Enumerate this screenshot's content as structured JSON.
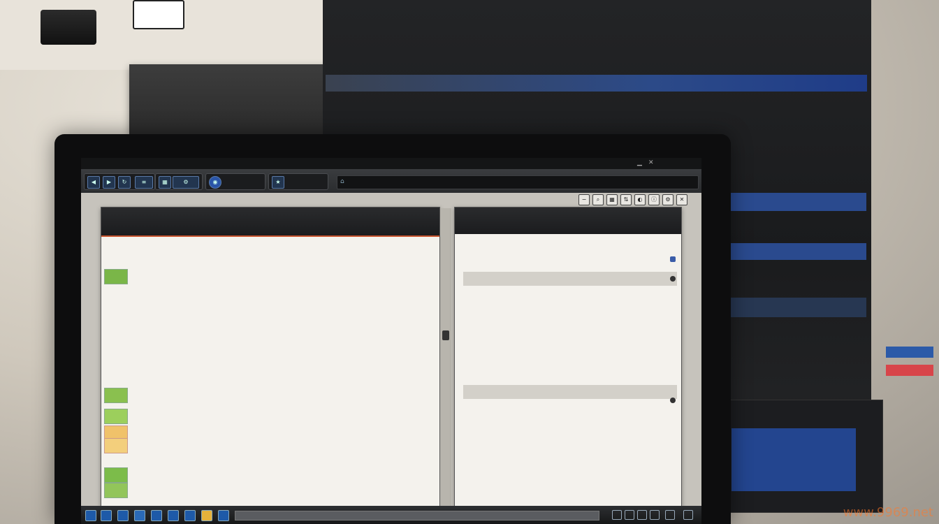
{
  "background": {
    "left_captions": [
      "",
      "",
      "",
      "",
      ""
    ],
    "mid_panel_title": "",
    "main_columns": [
      "",
      "",
      "",
      ""
    ],
    "blue_bar_text": ""
  },
  "window": {
    "title": "",
    "toolbar_labels": [
      "",
      ""
    ]
  },
  "left_pane": {
    "title": "",
    "controls": "",
    "lines": [
      "",
      "",
      "",
      "",
      "",
      "",
      "",
      "",
      "",
      "",
      "",
      "",
      "",
      "",
      "",
      "",
      "",
      "",
      "",
      "",
      "",
      "",
      "",
      "",
      "",
      ""
    ]
  },
  "right_pane": {
    "title": "",
    "controls": "",
    "lines": [
      "",
      "",
      "",
      "",
      "",
      "",
      "",
      "",
      "",
      "",
      "",
      "",
      "",
      "",
      "",
      "",
      "",
      "",
      "",
      "",
      "",
      "",
      "",
      "",
      "",
      ""
    ]
  },
  "watermark": "www.9969.net",
  "colors": {
    "accent_blue": "#2a4a8e",
    "title_blue": "#6fb0e8",
    "pane_accent": "#c8542e"
  }
}
